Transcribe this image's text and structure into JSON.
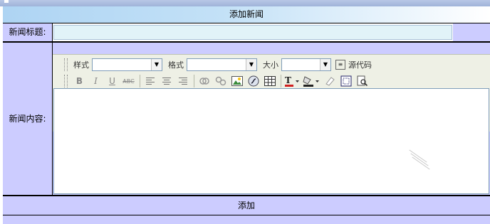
{
  "form": {
    "header_title": "添加新闻",
    "title_label": "新闻标题:",
    "title_value": "",
    "content_label": "新闻内容:",
    "submit_label": "添加"
  },
  "toolbar": {
    "style_label": "样式",
    "format_label": "格式",
    "size_label": "大小",
    "source_label": "源代码",
    "style_value": "",
    "format_value": "",
    "size_value": ""
  },
  "icons": {
    "bold": "B",
    "italic": "I",
    "underline": "U",
    "strike": "ABC"
  }
}
